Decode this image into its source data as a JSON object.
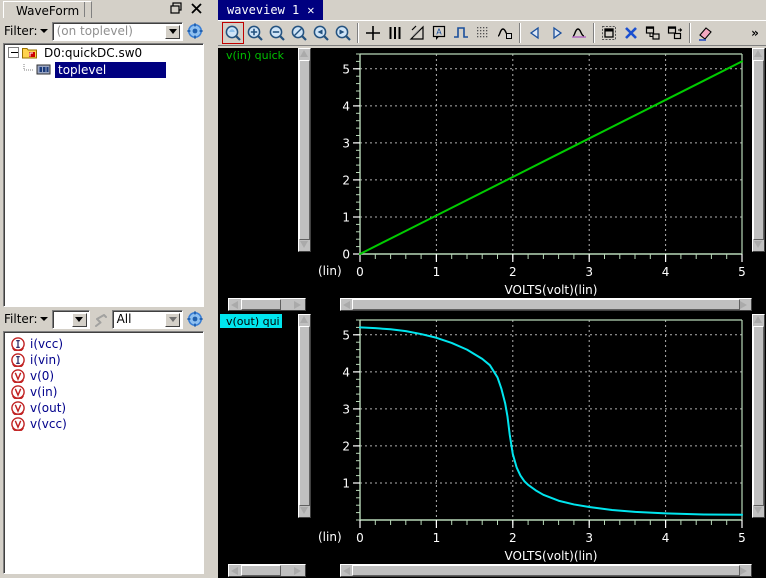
{
  "left_dock": {
    "tab_label": "WaveForm",
    "restore_icon": "restore-icon",
    "close_icon": "close-icon",
    "filter_top": {
      "label": "Filter:",
      "caret_icon": "caret-down-icon",
      "combo_placeholder": "(on toplevel)",
      "combo_value": "",
      "gear_icon": "gear-icon"
    },
    "tree": {
      "root": {
        "label": "D0:quickDC.sw0",
        "icon": "folder-icon",
        "expanded": true
      },
      "children": [
        {
          "label": "toplevel",
          "icon": "chip-icon",
          "selected": true
        }
      ]
    },
    "filter_bottom": {
      "label": "Filter:",
      "caret_icon": "caret-down-icon",
      "small_combo_value": "",
      "pin_icon": "pin-icon",
      "type_combo_value": "All",
      "gear_icon": "gear-icon"
    },
    "signals": [
      {
        "name": "i(vcc)",
        "icon": "current-signal-icon"
      },
      {
        "name": "i(vin)",
        "icon": "current-signal-icon"
      },
      {
        "name": "v(0)",
        "icon": "voltage-signal-icon"
      },
      {
        "name": "v(in)",
        "icon": "voltage-signal-icon"
      },
      {
        "name": "v(out)",
        "icon": "voltage-signal-icon"
      },
      {
        "name": "v(vcc)",
        "icon": "voltage-signal-icon"
      }
    ]
  },
  "wave_dock": {
    "tab": {
      "label": "waveview 1",
      "close_icon": "close-icon",
      "active": true
    },
    "toolbar": {
      "overflow_label": "»",
      "buttons": [
        {
          "name": "zoom-fit-icon",
          "active": true
        },
        {
          "name": "zoom-in-icon",
          "active": false
        },
        {
          "name": "zoom-out-icon",
          "active": false
        },
        {
          "name": "zoom-area-icon",
          "active": false
        },
        {
          "name": "zoom-previous-icon",
          "active": false
        },
        {
          "name": "zoom-next-icon",
          "active": false
        },
        {
          "name": "crosshair-cursor-icon",
          "active": false
        },
        {
          "name": "vertical-bars-icon",
          "active": false
        },
        {
          "name": "slope-measure-icon",
          "active": false
        },
        {
          "name": "text-annotation-icon",
          "active": false
        },
        {
          "name": "digital-step-icon",
          "active": false
        },
        {
          "name": "dot-grid-icon",
          "active": false
        },
        {
          "name": "waveform-marker-icon",
          "active": false
        },
        {
          "name": "previous-edge-icon",
          "active": false
        },
        {
          "name": "next-edge-icon",
          "active": false
        },
        {
          "name": "waveform-cursor-icon",
          "active": false
        },
        {
          "name": "panel-layout-icon",
          "active": false
        },
        {
          "name": "delete-icon",
          "active": false
        },
        {
          "name": "split-panel-icon",
          "active": false
        },
        {
          "name": "duplicate-panel-icon",
          "active": false
        },
        {
          "name": "eraser-icon",
          "active": false
        }
      ]
    },
    "panels": [
      {
        "label": "v(in) quick",
        "label_state": "normal",
        "scale_label": "(lin)",
        "x_axis_title": "VOLTS(volt)(lin)"
      },
      {
        "label": "v(out) qui",
        "label_state": "selected",
        "scale_label": "(lin)",
        "x_axis_title": "VOLTS(volt)(lin)"
      }
    ]
  },
  "colors": {
    "trace_vin": "#00cc00",
    "trace_vout": "#00e5ee",
    "plot_bg": "#000000",
    "grid": "#b0b0b0",
    "axis": "#b8d8b8",
    "tab_active_bg": "#000080",
    "chrome": "#d4d0c8",
    "tree_select": "#000080"
  },
  "chart_data": [
    {
      "type": "line",
      "title": "v(in) quick",
      "xlabel": "VOLTS(volt)(lin)",
      "ylabel": "",
      "scale": "(lin)",
      "xlim": [
        0,
        5
      ],
      "ylim": [
        0,
        5.4
      ],
      "xticks": [
        0,
        1,
        2,
        3,
        4,
        5
      ],
      "yticks": [
        0,
        1,
        2,
        3,
        4,
        5
      ],
      "grid": true,
      "legend": "none",
      "series": [
        {
          "name": "v(in)",
          "color": "#00cc00",
          "x": [
            0,
            0.5,
            1,
            1.5,
            2,
            2.5,
            3,
            3.5,
            4,
            4.5,
            5
          ],
          "values": [
            0,
            0.52,
            1.04,
            1.56,
            2.08,
            2.6,
            3.12,
            3.64,
            4.16,
            4.68,
            5.2
          ]
        }
      ]
    },
    {
      "type": "line",
      "title": "v(out) quick",
      "xlabel": "VOLTS(volt)(lin)",
      "ylabel": "",
      "scale": "(lin)",
      "xlim": [
        0,
        5
      ],
      "ylim": [
        0,
        5.4
      ],
      "xticks": [
        0,
        1,
        2,
        3,
        4,
        5
      ],
      "yticks": [
        1,
        2,
        3,
        4,
        5
      ],
      "grid": true,
      "legend": "none",
      "series": [
        {
          "name": "v(out)",
          "color": "#00e5ee",
          "x": [
            0,
            0.2,
            0.4,
            0.6,
            0.8,
            1.0,
            1.2,
            1.4,
            1.6,
            1.7,
            1.8,
            1.85,
            1.9,
            1.93,
            1.96,
            2.0,
            2.05,
            2.1,
            2.15,
            2.2,
            2.3,
            2.4,
            2.6,
            2.8,
            3.0,
            3.3,
            3.6,
            4.0,
            4.5,
            5.0
          ],
          "values": [
            5.2,
            5.18,
            5.15,
            5.1,
            5.02,
            4.92,
            4.78,
            4.6,
            4.35,
            4.18,
            3.85,
            3.55,
            3.15,
            2.8,
            2.3,
            1.78,
            1.42,
            1.2,
            1.05,
            0.95,
            0.8,
            0.68,
            0.52,
            0.42,
            0.35,
            0.27,
            0.22,
            0.18,
            0.15,
            0.14
          ]
        }
      ]
    }
  ]
}
